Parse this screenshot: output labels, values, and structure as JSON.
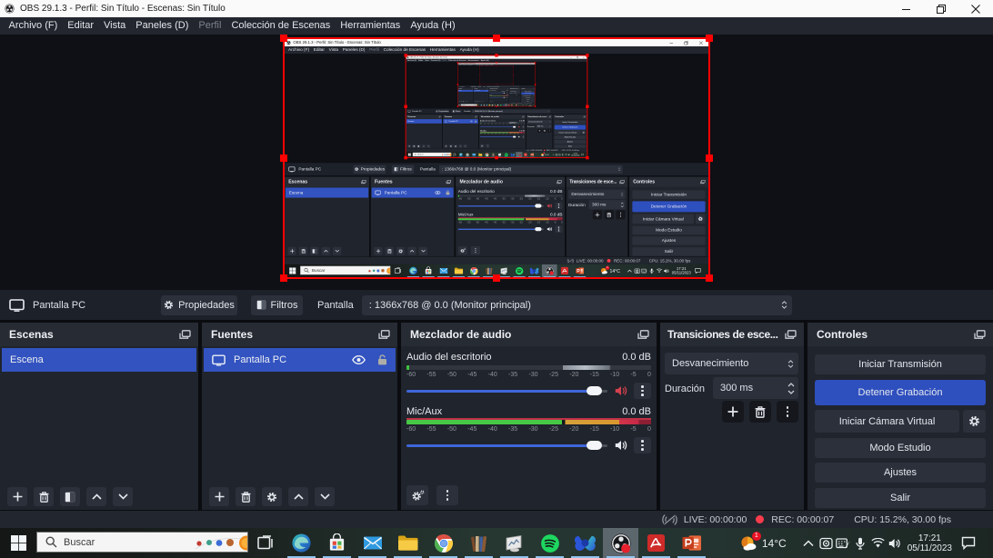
{
  "window": {
    "title": "OBS 29.1.3 - Perfil: Sin Título - Escenas: Sin Título"
  },
  "menu": {
    "items": [
      "Archivo (F)",
      "Editar",
      "Vista",
      "Paneles (D)",
      "Perfil",
      "Colección de Escenas",
      "Herramientas",
      "Ayuda (H)"
    ]
  },
  "preview": {
    "selection_color": "#ff0000"
  },
  "context_bar": {
    "source_label": "Pantalla PC",
    "properties_label": "Propiedades",
    "filters_label": "Filtros",
    "field_label": "Pantalla",
    "field_value": ": 1366x768 @ 0.0 (Monitor principal)"
  },
  "docks": {
    "scenes": {
      "title": "Escenas",
      "selected_item": "Escena"
    },
    "sources": {
      "title": "Fuentes",
      "selected_item": "Pantalla PC"
    },
    "mixer": {
      "title": "Mezclador de audio",
      "ticks": [
        "-60",
        "-55",
        "-50",
        "-45",
        "-40",
        "-35",
        "-30",
        "-25",
        "-20",
        "-15",
        "-10",
        "-5",
        "0"
      ],
      "channels": [
        {
          "name": "Audio del escritorio",
          "db": "0.0 dB",
          "muted": true
        },
        {
          "name": "Mic/Aux",
          "db": "0.0 dB",
          "muted": false
        }
      ]
    },
    "transitions": {
      "title": "Transiciones de esce...",
      "transition": "Desvanecimiento",
      "duration_label": "Duración",
      "duration_value": "300 ms"
    },
    "controls": {
      "title": "Controles",
      "start_stream": "Iniciar Transmisión",
      "stop_record": "Detener Grabación",
      "virtual_cam": "Iniciar Cámara Virtual",
      "studio_mode": "Modo Estudio",
      "settings": "Ajustes",
      "exit": "Salir"
    }
  },
  "status_bar": {
    "live": "LIVE: 00:00:00",
    "rec": "REC: 00:00:07",
    "cpu": "CPU: 15.2%, 30.00 fps"
  },
  "taskbar": {
    "search_placeholder": "Buscar",
    "weather_temp": "14°C",
    "weather_badge": "1",
    "time": "17:21",
    "date": "05/11/2023",
    "icons": [
      "task-view",
      "edge",
      "store",
      "mail",
      "explorer",
      "chrome",
      "books",
      "media-player",
      "spotify",
      "wondershare",
      "obs-studio",
      "acrobat",
      "powerpoint"
    ]
  }
}
